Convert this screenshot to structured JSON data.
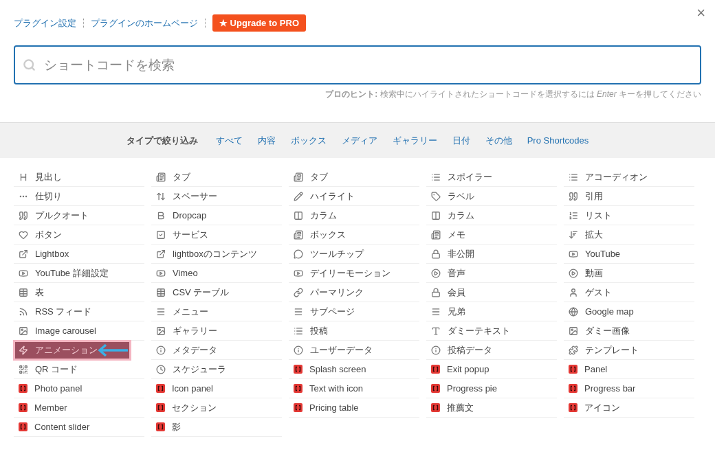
{
  "header": {
    "links": [
      "プラグイン設定",
      "プラグインのホームページ"
    ],
    "upgrade_button": "★ Upgrade to PRO",
    "close": "×"
  },
  "search": {
    "placeholder": "ショートコードを検索"
  },
  "hint": {
    "text": "**プロのヒント:** 検索中にハイライトされたショートコードを選択するには *Enter* キーを押してください"
  },
  "filter": {
    "label": "タイプで絞り込み",
    "options": [
      "すべて",
      "内容",
      "ボックス",
      "メディア",
      "ギャラリー",
      "日付",
      "その他",
      "Pro Shortcodes"
    ]
  },
  "shortcodes": [
    {
      "label": "見出し",
      "kind": "heading",
      "selected": false
    },
    {
      "label": "タブ",
      "kind": "panel",
      "selected": false
    },
    {
      "label": "タブ",
      "kind": "panel",
      "selected": false
    },
    {
      "label": "スポイラー",
      "kind": "list",
      "selected": false
    },
    {
      "label": "アコーディオン",
      "kind": "list",
      "selected": false
    },
    {
      "label": "仕切り",
      "kind": "divider",
      "selected": false
    },
    {
      "label": "スペーサー",
      "kind": "spacer",
      "selected": false
    },
    {
      "label": "ハイライト",
      "kind": "pencil",
      "selected": false
    },
    {
      "label": "ラベル",
      "kind": "tag",
      "selected": false
    },
    {
      "label": "引用",
      "kind": "quote",
      "selected": false
    },
    {
      "label": "プルクオート",
      "kind": "quote",
      "selected": false
    },
    {
      "label": "Dropcap",
      "kind": "bold",
      "selected": false
    },
    {
      "label": "カラム",
      "kind": "columns",
      "selected": false
    },
    {
      "label": "カラム",
      "kind": "columns",
      "selected": false
    },
    {
      "label": "リスト",
      "kind": "ordered",
      "selected": false
    },
    {
      "label": "ボタン",
      "kind": "heart",
      "selected": false
    },
    {
      "label": "サービス",
      "kind": "check",
      "selected": false
    },
    {
      "label": "ボックス",
      "kind": "panel",
      "selected": false
    },
    {
      "label": "メモ",
      "kind": "panel",
      "selected": false
    },
    {
      "label": "拡大",
      "kind": "sort",
      "selected": false
    },
    {
      "label": "Lightbox",
      "kind": "external",
      "selected": false
    },
    {
      "label": "lightboxのコンテンツ",
      "kind": "external",
      "selected": false
    },
    {
      "label": "ツールチップ",
      "kind": "bubble",
      "selected": false
    },
    {
      "label": "非公開",
      "kind": "lock",
      "selected": false
    },
    {
      "label": "YouTube",
      "kind": "video",
      "selected": false
    },
    {
      "label": "YouTube 詳細設定",
      "kind": "video",
      "selected": false
    },
    {
      "label": "Vimeo",
      "kind": "video",
      "selected": false
    },
    {
      "label": "デイリーモーション",
      "kind": "video",
      "selected": false
    },
    {
      "label": "音声",
      "kind": "play",
      "selected": false
    },
    {
      "label": "動画",
      "kind": "play",
      "selected": false
    },
    {
      "label": "表",
      "kind": "table",
      "selected": false
    },
    {
      "label": "CSV テーブル",
      "kind": "table",
      "selected": false
    },
    {
      "label": "パーマリンク",
      "kind": "link",
      "selected": false
    },
    {
      "label": "会員",
      "kind": "lock",
      "selected": false
    },
    {
      "label": "ゲスト",
      "kind": "user",
      "selected": false
    },
    {
      "label": "RSS フィード",
      "kind": "rss",
      "selected": false
    },
    {
      "label": "メニュー",
      "kind": "menu",
      "selected": false
    },
    {
      "label": "サブページ",
      "kind": "menu",
      "selected": false
    },
    {
      "label": "兄弟",
      "kind": "menu",
      "selected": false
    },
    {
      "label": "Google map",
      "kind": "globe",
      "selected": false
    },
    {
      "label": "Image carousel",
      "kind": "image",
      "selected": false
    },
    {
      "label": "ギャラリー",
      "kind": "image",
      "selected": false
    },
    {
      "label": "投稿",
      "kind": "list",
      "selected": false
    },
    {
      "label": "ダミーテキスト",
      "kind": "type",
      "selected": false
    },
    {
      "label": "ダミー画像",
      "kind": "image",
      "selected": false
    },
    {
      "label": "アニメーション",
      "kind": "bolt",
      "selected": true
    },
    {
      "label": "メタデータ",
      "kind": "info",
      "selected": false
    },
    {
      "label": "ユーザーデータ",
      "kind": "info",
      "selected": false
    },
    {
      "label": "投稿データ",
      "kind": "info",
      "selected": false
    },
    {
      "label": "テンプレート",
      "kind": "puzzle",
      "selected": false
    },
    {
      "label": "QR コード",
      "kind": "qr",
      "selected": false
    },
    {
      "label": "スケジューラ",
      "kind": "clock",
      "selected": false
    },
    {
      "label": "Splash screen",
      "kind": "pro",
      "selected": false
    },
    {
      "label": "Exit popup",
      "kind": "pro",
      "selected": false
    },
    {
      "label": "Panel",
      "kind": "pro",
      "selected": false
    },
    {
      "label": "Photo panel",
      "kind": "pro",
      "selected": false
    },
    {
      "label": "Icon panel",
      "kind": "pro",
      "selected": false
    },
    {
      "label": "Text with icon",
      "kind": "pro",
      "selected": false
    },
    {
      "label": "Progress pie",
      "kind": "pro",
      "selected": false
    },
    {
      "label": "Progress bar",
      "kind": "pro",
      "selected": false
    },
    {
      "label": "Member",
      "kind": "pro",
      "selected": false
    },
    {
      "label": "セクション",
      "kind": "pro",
      "selected": false
    },
    {
      "label": "Pricing table",
      "kind": "pro",
      "selected": false
    },
    {
      "label": "推薦文",
      "kind": "pro",
      "selected": false
    },
    {
      "label": "アイコン",
      "kind": "pro",
      "selected": false
    },
    {
      "label": "Content slider",
      "kind": "pro",
      "selected": false
    },
    {
      "label": "影",
      "kind": "pro",
      "selected": false
    }
  ]
}
